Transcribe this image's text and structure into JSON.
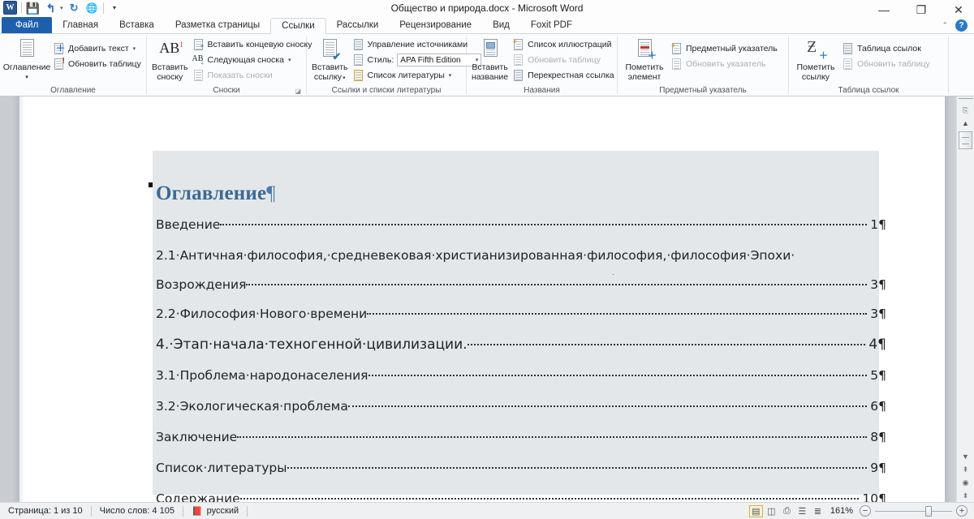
{
  "window": {
    "title": "Общество и природа.docx  -  Microsoft Word",
    "logo_letter": "W",
    "minimize": "—",
    "restore": "❐",
    "close": "✕",
    "collapse_ribbon": "⌃",
    "help": "?"
  },
  "quick_access": {
    "save": "save-icon",
    "undo": "undo-icon",
    "redo": "redo-icon",
    "globe": "globe-icon",
    "customize": "customize-icon"
  },
  "tabs": [
    {
      "label": "Файл",
      "kind": "file"
    },
    {
      "label": "Главная",
      "kind": "normal"
    },
    {
      "label": "Вставка",
      "kind": "normal"
    },
    {
      "label": "Разметка страницы",
      "kind": "normal"
    },
    {
      "label": "Ссылки",
      "kind": "active"
    },
    {
      "label": "Рассылки",
      "kind": "normal"
    },
    {
      "label": "Рецензирование",
      "kind": "normal"
    },
    {
      "label": "Вид",
      "kind": "normal"
    },
    {
      "label": "Foxit PDF",
      "kind": "normal"
    }
  ],
  "ribbon": {
    "groups": [
      {
        "name": "Оглавление",
        "big": [
          {
            "label_line1": "Оглавление",
            "label_line2": "",
            "caret": "▾"
          }
        ],
        "small": [
          {
            "label": "Добавить текст",
            "caret": "▾",
            "disabled": false
          },
          {
            "label": "Обновить таблицу",
            "caret": "",
            "disabled": false
          }
        ]
      },
      {
        "name": "Сноски",
        "launcher": "◪",
        "big": [
          {
            "label_line1": "Вставить",
            "label_line2": "сноску",
            "caret": ""
          }
        ],
        "small": [
          {
            "label": "Вставить концевую сноску",
            "caret": "",
            "disabled": false
          },
          {
            "label": "Следующая сноска",
            "caret": "▾",
            "disabled": false
          },
          {
            "label": "Показать сноски",
            "caret": "",
            "disabled": true
          }
        ]
      },
      {
        "name": "Ссылки и списки литературы",
        "big": [
          {
            "label_line1": "Вставить",
            "label_line2": "ссылку",
            "caret": "▾"
          }
        ],
        "small": [
          {
            "label": "Управление источниками",
            "caret": "",
            "disabled": false
          },
          {
            "label": "Список литературы",
            "caret": "▾",
            "disabled": false
          }
        ],
        "style_label": "Стиль:",
        "style_value": "APA Fifth Edition",
        "style_caret": "▾"
      },
      {
        "name": "Названия",
        "big": [
          {
            "label_line1": "Вставить",
            "label_line2": "название",
            "caret": ""
          }
        ],
        "small": [
          {
            "label": "Список иллюстраций",
            "caret": "",
            "disabled": false
          },
          {
            "label": "Обновить таблицу",
            "caret": "",
            "disabled": true
          },
          {
            "label": "Перекрестная ссылка",
            "caret": "",
            "disabled": false
          }
        ]
      },
      {
        "name": "Предметный указатель",
        "big": [
          {
            "label_line1": "Пометить",
            "label_line2": "элемент",
            "caret": ""
          }
        ],
        "small": [
          {
            "label": "Предметный указатель",
            "caret": "",
            "disabled": false
          },
          {
            "label": "Обновить указатель",
            "caret": "",
            "disabled": true
          }
        ]
      },
      {
        "name": "Таблица ссылок",
        "big": [
          {
            "label_line1": "Пометить",
            "label_line2": "ссылку",
            "caret": ""
          }
        ],
        "small": [
          {
            "label": "Таблица ссылок",
            "caret": "",
            "disabled": false
          },
          {
            "label": "Обновить таблицу",
            "caret": "",
            "disabled": true
          }
        ]
      }
    ]
  },
  "document": {
    "heading": "Оглавление",
    "pilcrow": "¶",
    "tab_arrow": "→",
    "entries": [
      {
        "label": "Введение ",
        "label2": "",
        "page": "1",
        "big": false
      },
      {
        "label": "2.1·Античная·философия,·средневековая·христианизированная·философия,·философия·Эпохи·",
        "label2": "Возрождения",
        "page": "3",
        "big": false
      },
      {
        "label": "2.2·Философия·Нового·времени",
        "label2": "",
        "page": "3",
        "big": false
      },
      {
        "label": "4.·Этап·начала·техногенной·цивилизации. ",
        "label2": "",
        "page": "4",
        "big": true
      },
      {
        "label": "3.1·Проблема·народонаселения",
        "label2": "",
        "page": "5",
        "big": false
      },
      {
        "label": "3.2·Экологическая·проблема ",
        "label2": "",
        "page": "6",
        "big": false
      },
      {
        "label": "Заключение ",
        "label2": "",
        "page": "8",
        "big": false
      },
      {
        "label": "Список·литературы ",
        "label2": "",
        "page": "9",
        "big": false
      },
      {
        "label": "Содержание",
        "label2": "",
        "page": "10",
        "big": false
      }
    ]
  },
  "status_bar": {
    "page_info": "Страница: 1 из 10",
    "word_count": "Число слов: 4 105",
    "language": "русский",
    "proofing_icon": "proofing-errors-icon",
    "view_buttons": [
      {
        "name": "print-layout-view",
        "glyph": "▤",
        "selected": true
      },
      {
        "name": "full-screen-reading-view",
        "glyph": "◫",
        "selected": false
      },
      {
        "name": "web-layout-view",
        "glyph": "⎙",
        "selected": false
      },
      {
        "name": "outline-view",
        "glyph": "☰",
        "selected": false
      },
      {
        "name": "draft-view",
        "glyph": "≣",
        "selected": false
      }
    ],
    "zoom_level": "161%",
    "zoom_out": "−",
    "zoom_in": "+"
  },
  "scrollbar": {
    "split_handle": "split-bar",
    "select_browse_object": "◉",
    "arrow_up": "▲",
    "arrow_down": "▼",
    "previous_page": "⇞",
    "next_page": "⇟"
  }
}
